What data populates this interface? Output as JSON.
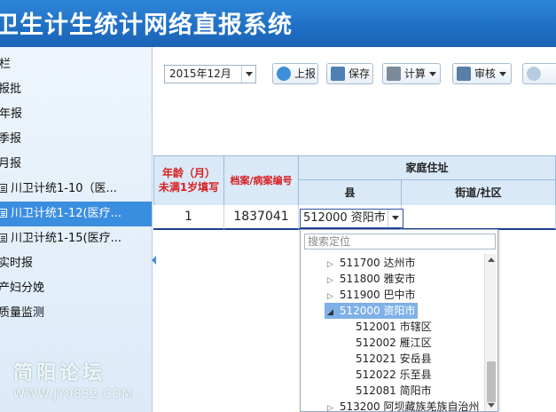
{
  "app": {
    "title": "卫生计生统计网络直报系统"
  },
  "sidebar": {
    "items": [
      {
        "label": "栏"
      },
      {
        "label": "报批"
      },
      {
        "label": "年报"
      },
      {
        "label": "季报"
      },
      {
        "label": "月报"
      },
      {
        "label": "川卫计统1-10（医..."
      },
      {
        "label": "川卫计统1-12(医疗..."
      },
      {
        "label": "川卫计统1-15(医疗..."
      },
      {
        "label": "实时报"
      },
      {
        "label": "产妇分娩"
      },
      {
        "label": "质量监测"
      }
    ],
    "watermark": "简阳论坛",
    "watermark_url": "WWW.JY0832.COM"
  },
  "toolbar": {
    "period_value": "2015年12月",
    "report_label": "上报",
    "save_label": "保存",
    "calc_label": "计算",
    "audit_label": "审核"
  },
  "table": {
    "headers": {
      "age": "年龄（月）",
      "age_note": "未满1岁填写",
      "record_no": "档案/病案编号",
      "address": "家庭住址",
      "county": "县",
      "street": "街道/社区"
    },
    "row": {
      "age": "1",
      "record_no": "1837041",
      "county": "512000 资阳市"
    }
  },
  "dropdown": {
    "search_placeholder": "搜索定位",
    "items": [
      {
        "label": "511700 达州市",
        "toggle": "▷"
      },
      {
        "label": "511800 雅安市",
        "toggle": "▷"
      },
      {
        "label": "511900 巴中市",
        "toggle": "▷"
      },
      {
        "label": "512000 资阳市",
        "toggle": "◢"
      },
      {
        "label": "512001 市辖区",
        "toggle": ""
      },
      {
        "label": "512002 雁江区",
        "toggle": ""
      },
      {
        "label": "512021 安岳县",
        "toggle": ""
      },
      {
        "label": "512022 乐至县",
        "toggle": ""
      },
      {
        "label": "512081 简阳市",
        "toggle": ""
      },
      {
        "label": "513200 阿坝藏族羌族自治州",
        "toggle": "▷"
      }
    ]
  }
}
